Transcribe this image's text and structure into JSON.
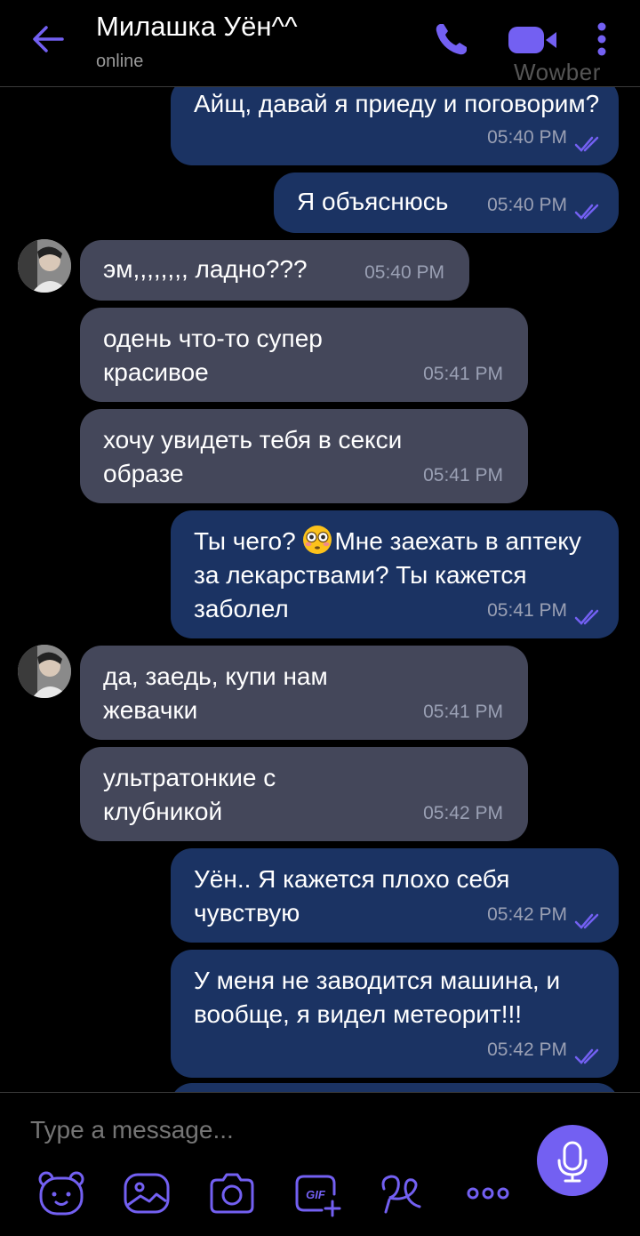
{
  "header": {
    "title": "Милашка Уён^^",
    "status": "online",
    "watermark": "Wowber"
  },
  "messages": [
    {
      "dir": "out",
      "text": "Айщ, давай я приеду и поговорим?",
      "time": "05:40 PM"
    },
    {
      "dir": "out",
      "text": "Я объяснюсь",
      "time": "05:40 PM"
    },
    {
      "dir": "in",
      "text": "эм,,,,,,,, ладно???",
      "time": "05:40 PM"
    },
    {
      "dir": "in",
      "text": "одень что-то супер красивое",
      "time": "05:41 PM"
    },
    {
      "dir": "in",
      "text": "хочу увидеть тебя в секси образе",
      "time": "05:41 PM"
    },
    {
      "dir": "out",
      "text_before": "Ты чего? ",
      "emoji": "flushed-face",
      "text_after": "Мне заехать в аптеку за лекарствами? Ты кажется заболел",
      "time": "05:41 PM"
    },
    {
      "dir": "in",
      "text": "да, заедь, купи нам жевачки",
      "time": "05:41 PM"
    },
    {
      "dir": "in",
      "text": "ультратонкие с клубникой",
      "time": "05:42 PM"
    },
    {
      "dir": "out",
      "text": "Уён.. Я кажется плохо себя чувствую",
      "time": "05:42 PM"
    },
    {
      "dir": "out",
      "text": "У меня не заводится машина, и вообще, я видел метеорит!!!",
      "time": "05:42 PM"
    }
  ],
  "composer": {
    "placeholder": "Type a message..."
  },
  "colors": {
    "accent": "#7360f2",
    "outgoing_bubble": "#1b3363",
    "incoming_bubble": "#44475a",
    "background": "#000000"
  }
}
